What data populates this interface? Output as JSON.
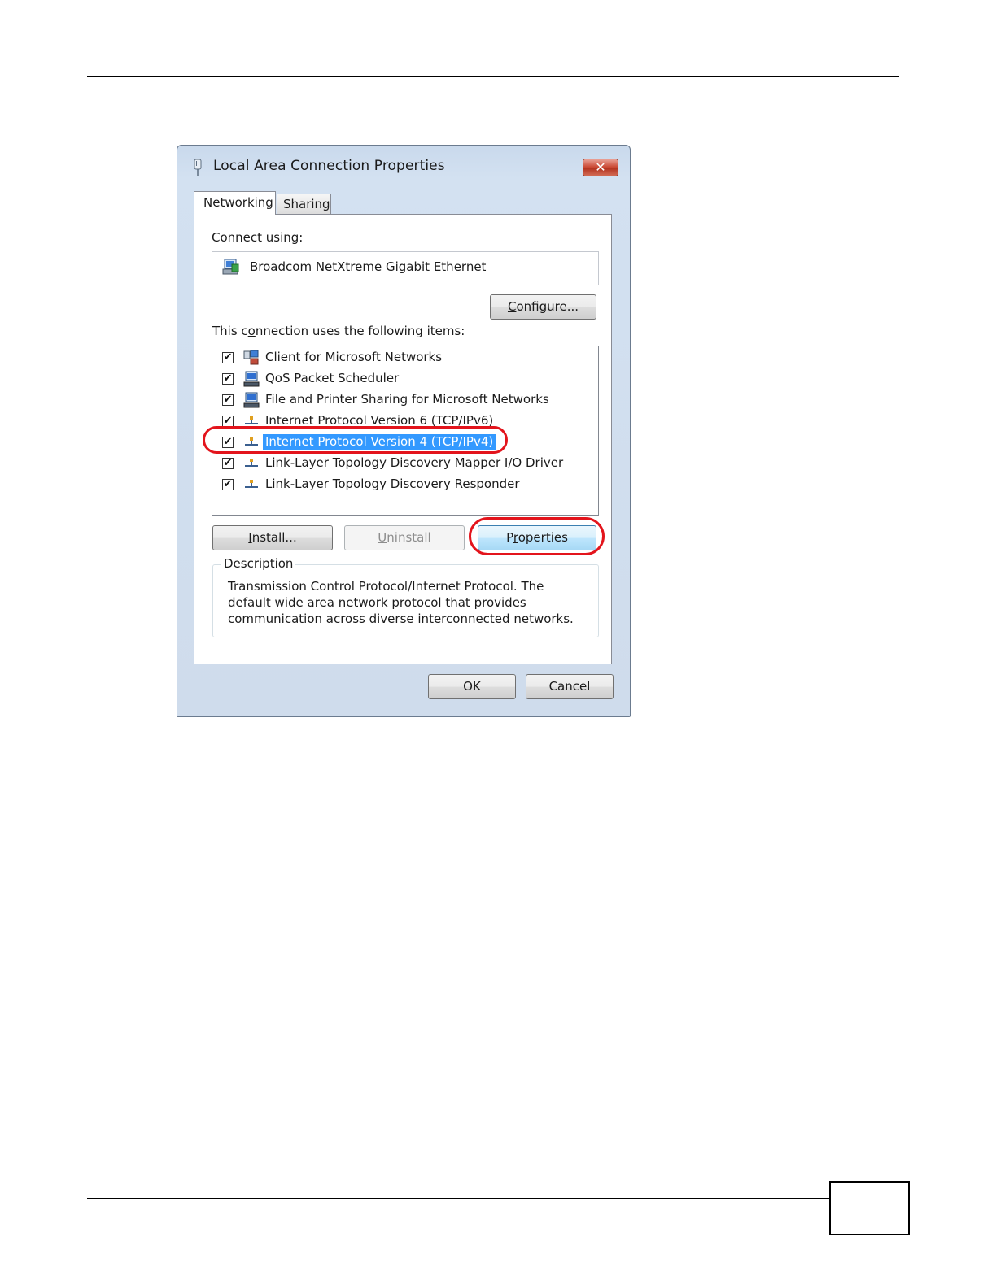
{
  "dialog": {
    "title": "Local Area Connection Properties",
    "close_label": "✕",
    "tabs": [
      {
        "label": "Networking",
        "active": true
      },
      {
        "label": "Sharing",
        "active": false
      }
    ],
    "connect_using_label": "Connect using:",
    "adapter_name": "Broadcom NetXtreme Gigabit Ethernet",
    "configure_label": "Configure...",
    "items_label": "This connection uses the following items:",
    "items": [
      {
        "label": "Client for Microsoft Networks",
        "checked": true,
        "icon": "network-client-icon"
      },
      {
        "label": "QoS Packet Scheduler",
        "checked": true,
        "icon": "service-computer-icon"
      },
      {
        "label": "File and Printer Sharing for Microsoft Networks",
        "checked": true,
        "icon": "service-computer-icon"
      },
      {
        "label": "Internet Protocol Version 6 (TCP/IPv6)",
        "checked": true,
        "icon": "protocol-icon"
      },
      {
        "label": "Internet Protocol Version 4 (TCP/IPv4)",
        "checked": true,
        "icon": "protocol-icon",
        "selected": true
      },
      {
        "label": "Link-Layer Topology Discovery Mapper I/O Driver",
        "checked": true,
        "icon": "protocol-icon"
      },
      {
        "label": "Link-Layer Topology Discovery Responder",
        "checked": true,
        "icon": "protocol-icon"
      }
    ],
    "install_label": "Install...",
    "uninstall_label": "Uninstall",
    "properties_label": "Properties",
    "description_legend": "Description",
    "description_text": "Transmission Control Protocol/Internet Protocol. The default wide area network protocol that provides communication across diverse interconnected networks.",
    "ok_label": "OK",
    "cancel_label": "Cancel",
    "check_glyph": "✔"
  },
  "colors": {
    "selection": "#3399ff",
    "callout": "#e3141c",
    "close_button": "#c8442f"
  }
}
